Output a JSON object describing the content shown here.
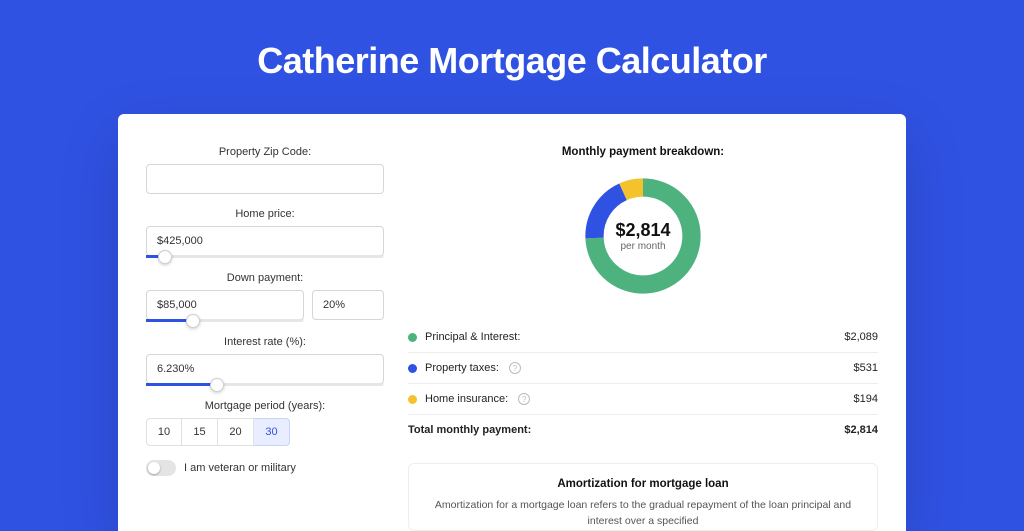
{
  "page_title": "Catherine Mortgage Calculator",
  "colors": {
    "brand": "#3052e3",
    "principal": "#4eb27f",
    "taxes": "#3052e3",
    "insurance": "#f4c22b"
  },
  "form": {
    "zip": {
      "label": "Property Zip Code:",
      "value": ""
    },
    "home_price": {
      "label": "Home price:",
      "value": "$425,000",
      "slider_pct": 8
    },
    "down_payment": {
      "label": "Down payment:",
      "amount": "$85,000",
      "percent": "20%",
      "slider_pct": 20
    },
    "interest_rate": {
      "label": "Interest rate (%):",
      "value": "6.230%",
      "slider_pct": 30
    },
    "mortgage_period": {
      "label": "Mortgage period (years):",
      "options": [
        "10",
        "15",
        "20",
        "30"
      ],
      "selected": "30"
    },
    "veteran": {
      "label": "I am veteran or military",
      "value": false
    }
  },
  "breakdown": {
    "title": "Monthly payment breakdown:",
    "total": "$2,814",
    "subtitle": "per month",
    "items": {
      "principal": {
        "label": "Principal & Interest:",
        "value": "$2,089"
      },
      "taxes": {
        "label": "Property taxes:",
        "value": "$531",
        "has_info": true
      },
      "insurance": {
        "label": "Home insurance:",
        "value": "$194",
        "has_info": true
      }
    },
    "total_row": {
      "label": "Total monthly payment:",
      "value": "$2,814"
    }
  },
  "amortization": {
    "title": "Amortization for mortgage loan",
    "body_snippet": "Amortization for a mortgage loan refers to the gradual repayment of the loan principal and interest over a specified"
  },
  "chart_data": {
    "type": "pie",
    "title": "Monthly payment breakdown",
    "total_label": "$2,814",
    "subtitle": "per month",
    "series": [
      {
        "name": "Principal & Interest",
        "value": 2089,
        "color": "#4eb27f"
      },
      {
        "name": "Property taxes",
        "value": 531,
        "color": "#3052e3"
      },
      {
        "name": "Home insurance",
        "value": 194,
        "color": "#f4c22b"
      }
    ],
    "_derived_pct": {
      "principal": 74.2,
      "taxes": 18.9,
      "insurance": 6.9
    }
  }
}
